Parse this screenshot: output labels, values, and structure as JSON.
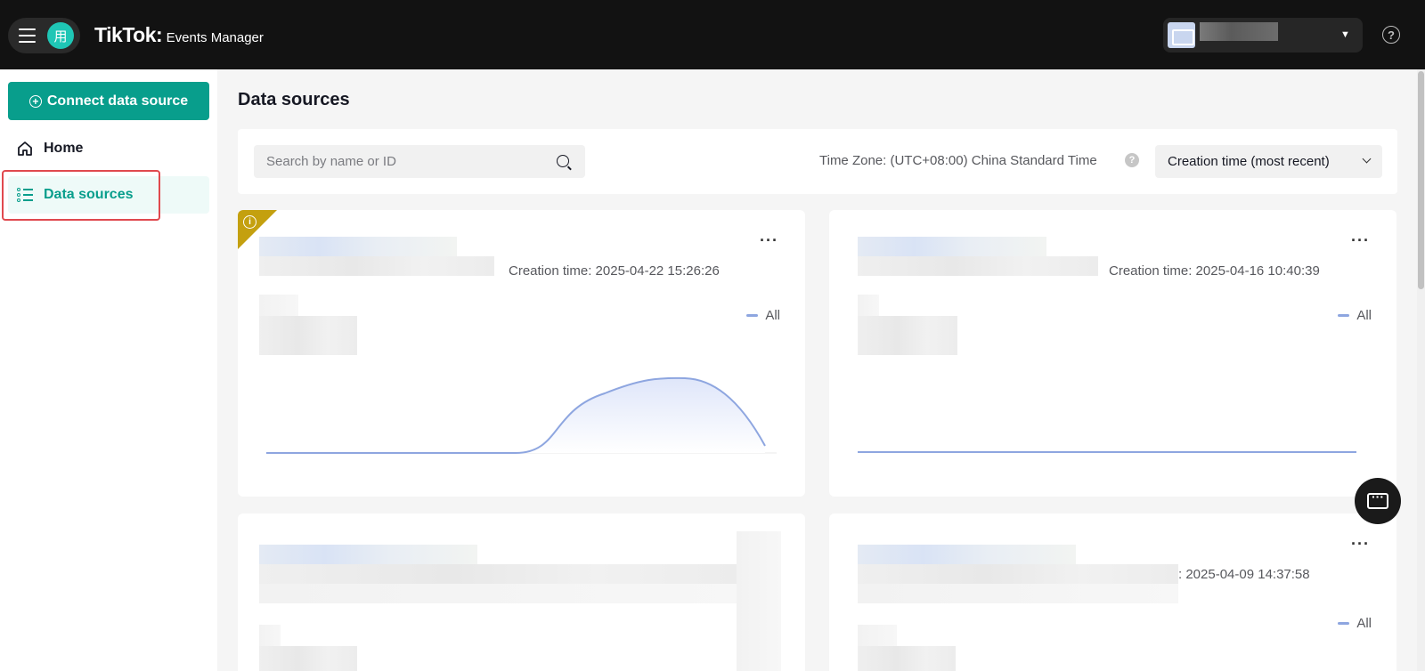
{
  "header": {
    "avatar_char": "用",
    "brand": "TikTok",
    "brand_sep": ":",
    "product": "Events Manager",
    "help_label": "?"
  },
  "sidebar": {
    "connect_label": "Connect data source",
    "items": [
      {
        "label": "Home",
        "icon": "home-icon"
      },
      {
        "label": "Data sources",
        "icon": "list-icon",
        "active": true
      }
    ]
  },
  "main": {
    "title": "Data sources",
    "search": {
      "placeholder": "Search by name or ID"
    },
    "timezone": "Time Zone: (UTC+08:00) China Standard Time",
    "sort": {
      "selected": "Creation time (most recent)"
    }
  },
  "cards": [
    {
      "creation_time": "Creation time: 2025-04-22 15:26:26",
      "legend": "All",
      "has_warning": true
    },
    {
      "creation_time": "Creation time: 2025-04-16 10:40:39",
      "legend": "All",
      "has_warning": false
    },
    {
      "creation_time": "",
      "legend": "",
      "has_warning": false
    },
    {
      "creation_time": ": 2025-04-09 14:37:58",
      "legend": "All",
      "has_warning": false
    }
  ],
  "colors": {
    "accent": "#089e8c",
    "series": "#8ea6e0",
    "warning": "#c4a00f",
    "highlight_outline": "#e0494e"
  }
}
